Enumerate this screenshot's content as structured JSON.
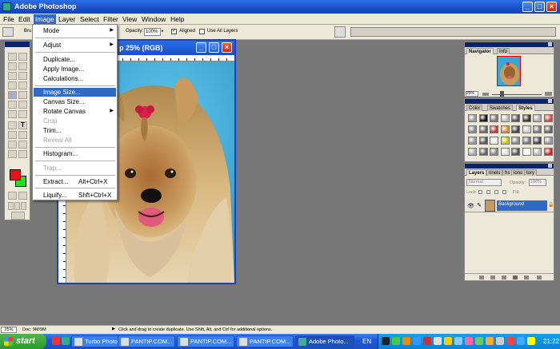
{
  "window": {
    "title": "Adobe Photoshop"
  },
  "menubar": [
    "File",
    "Edit",
    "Image",
    "Layer",
    "Select",
    "Filter",
    "View",
    "Window",
    "Help"
  ],
  "options_bar": {
    "brush_label": "Bru",
    "opacity_label": "Opacity:",
    "opacity_value": "100%",
    "aligned_label": "Aligned",
    "aligned_checked": true,
    "use_all_layers_label": "Use All Layers",
    "use_all_layers_checked": false
  },
  "document": {
    "title_visible": "p 25% (RGB)"
  },
  "image_menu": [
    {
      "label": "Mode",
      "submenu": true
    },
    {
      "sep": true
    },
    {
      "label": "Adjust",
      "submenu": true
    },
    {
      "sep": true
    },
    {
      "label": "Duplicate..."
    },
    {
      "label": "Apply Image..."
    },
    {
      "label": "Calculations..."
    },
    {
      "sep": true
    },
    {
      "label": "Image Size...",
      "selected": true
    },
    {
      "label": "Canvas Size..."
    },
    {
      "label": "Rotate Canvas",
      "submenu": true
    },
    {
      "label": "Crop",
      "disabled": true
    },
    {
      "label": "Trim..."
    },
    {
      "label": "Reveal All",
      "disabled": true
    },
    {
      "sep": true
    },
    {
      "label": "Histogram..."
    },
    {
      "sep": true
    },
    {
      "label": "Trap...",
      "disabled": true
    },
    {
      "sep": true
    },
    {
      "label": "Extract...",
      "shortcut": "Alt+Ctrl+X"
    },
    {
      "label": "Liquify...",
      "shortcut": "Shft+Ctrl+X"
    }
  ],
  "navigator_panel": {
    "tabs": [
      "Navigator",
      "Info"
    ],
    "zoom": "25%"
  },
  "styles_panel": {
    "tabs": [
      "Color",
      "Swatches",
      "Styles"
    ]
  },
  "layers_panel": {
    "tabs": [
      "Layers",
      "nnels",
      "hs",
      "ions",
      "tory"
    ],
    "blend_mode": "Normal",
    "opacity_label": "Opacity:",
    "opacity_value": "100%",
    "lock_label": "Lock:",
    "fill_label": "Fill:",
    "layer_name": "Background"
  },
  "status_bar": {
    "zoom": "25%",
    "doc_info": "Doc: 9M/9M",
    "hint": "Click and drag to create duplicate. Use Shift, Alt, and Ctrl for additional options."
  },
  "taskbar": {
    "start_label": "start",
    "tasks": [
      {
        "label": "Turbo Photo...",
        "active": false
      },
      {
        "label": "PANTIP.COM...",
        "active": false
      },
      {
        "label": "PANTIP.COM...",
        "active": false
      },
      {
        "label": "PANTIP.COM...",
        "active": false
      },
      {
        "label": "Adobe Photo...",
        "active": true
      }
    ],
    "language": "EN",
    "clock": "21:22"
  },
  "colors": {
    "foreground": "#f01010",
    "background": "#20e020",
    "accent": "#316ac5",
    "title_blue": "#1a4fc8"
  }
}
